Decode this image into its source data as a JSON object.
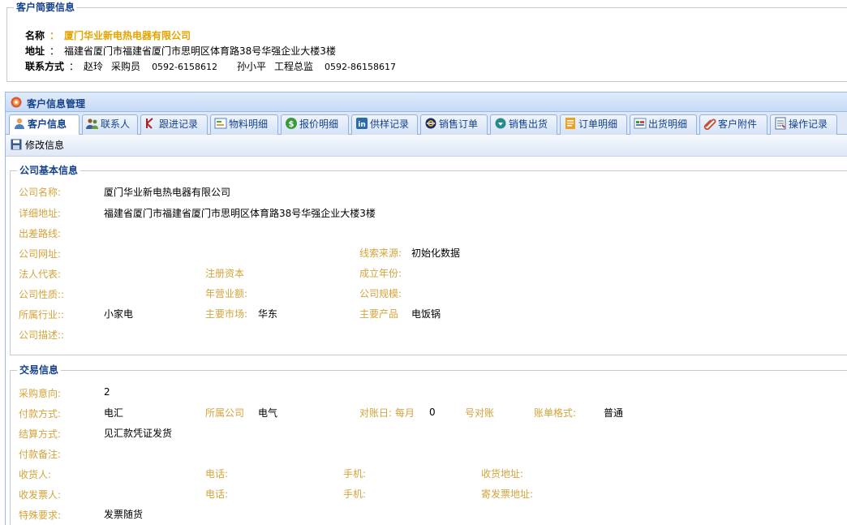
{
  "summary": {
    "legend": "客户简要信息",
    "name_label": "名称",
    "name_colon": "：",
    "name_value": "厦门华业新电热电器有限公司",
    "address_label": "地址",
    "address_colon": "：",
    "address_value": "福建省厦门市福建省厦门市思明区体育路38号华强企业大楼3楼",
    "contact_label": "联系方式",
    "contact_colon": "：",
    "contacts": [
      {
        "name": "赵玲",
        "title": "采购员",
        "phone": "0592-6158612"
      },
      {
        "name": "孙小平",
        "title": "工程总监",
        "phone": "0592-86158617"
      }
    ]
  },
  "panel": {
    "title": "客户信息管理",
    "tabs": [
      {
        "label": "客户信息",
        "icon": "user-icon",
        "active": true
      },
      {
        "label": "联系人",
        "icon": "contacts-icon"
      },
      {
        "label": "跟进记录",
        "icon": "follow-up-icon"
      },
      {
        "label": "物料明细",
        "icon": "materials-icon"
      },
      {
        "label": "报价明细",
        "icon": "dollar-icon"
      },
      {
        "label": "供样记录",
        "icon": "sample-icon"
      },
      {
        "label": "销售订单",
        "icon": "sales-order-icon"
      },
      {
        "label": "销售出货",
        "icon": "shipment-icon"
      },
      {
        "label": "订单明细",
        "icon": "order-detail-icon"
      },
      {
        "label": "出货明细",
        "icon": "shipment-detail-icon"
      },
      {
        "label": "客户附件",
        "icon": "attachment-icon"
      },
      {
        "label": "操作记录",
        "icon": "log-icon"
      }
    ],
    "toolbar": {
      "edit_label": "修改信息"
    }
  },
  "basic": {
    "legend": "公司基本信息",
    "company_name_label": "公司名称:",
    "company_name": "厦门华业新电热电器有限公司",
    "address_label": "详细地址:",
    "address": "福建省厦门市福建省厦门市思明区体育路38号华强企业大楼3楼",
    "route_label": "出差路线:",
    "website_label": "公司网址:",
    "lead_source_label": "线索来源:",
    "lead_source": "初始化数据",
    "legal_rep_label": "法人代表:",
    "capital_label": "注册资本",
    "founded_label": "成立年份:",
    "nature_label": "公司性质::",
    "revenue_label": "年营业额:",
    "scale_label": "公司规模:",
    "industry_label": "所属行业::",
    "industry": "小家电",
    "market_label": "主要市场:",
    "market": "华东",
    "product_label": "主要产品",
    "product": "电饭锅",
    "desc_label": "公司描述::"
  },
  "trade": {
    "legend": "交易信息",
    "intent_label": "采购意向:",
    "intent": "2",
    "payment_label": "付款方式:",
    "payment": "电汇",
    "company_label": "所属公司",
    "company": "电气",
    "recon_label": "对账日: 每月",
    "recon_day": "0",
    "recon_suffix": "号对账",
    "bill_format_label": "账单格式:",
    "bill_format": "普通",
    "settlement_label": "结算方式:",
    "settlement": "见汇款凭证发货",
    "payment_note_label": "付款备注:",
    "consignee_label": "收货人:",
    "phone_label_1": "电话:",
    "mobile_label_1": "手机:",
    "delivery_addr_label": "收货地址:",
    "invoice_receiver_label": "收发票人:",
    "phone_label_2": "电话:",
    "mobile_label_2": "手机:",
    "invoice_addr_label": "寄发票地址:",
    "special_label": "特殊要求:",
    "special": "发票随货"
  },
  "colors": {
    "label": "#d4a33a",
    "company_name": "#e4a400",
    "legend": "#15428b",
    "panel_border": "#99bbe8"
  }
}
